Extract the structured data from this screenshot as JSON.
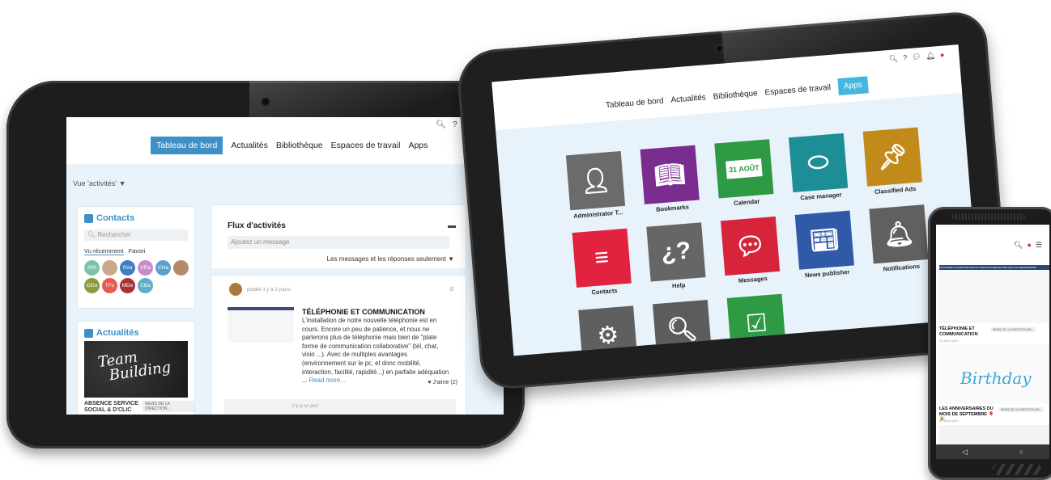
{
  "tablet_left": {
    "nav": {
      "items": [
        "Tableau de bord",
        "Actualités",
        "Bibliothèque",
        "Espaces de travail",
        "Apps"
      ],
      "active_index": 0
    },
    "view_selector": "Vue 'activités' ▼",
    "contacts": {
      "title": "Contacts",
      "search_placeholder": "Rechercher",
      "tabs": [
        "Vu récemment",
        "Favori"
      ],
      "avatars": [
        {
          "initials": "API",
          "color": "#7cc4a8"
        },
        {
          "initials": "",
          "color": "#c9a989"
        },
        {
          "initials": "SVa",
          "color": "#3d7fc4"
        },
        {
          "initials": "VRa",
          "color": "#c98ac9"
        },
        {
          "initials": "CHa",
          "color": "#5aa0d0"
        },
        {
          "initials": "",
          "color": "#b48a6a"
        },
        {
          "initials": "OGo",
          "color": "#8a9a3c"
        },
        {
          "initials": "TFo",
          "color": "#e85a4f"
        },
        {
          "initials": "MDe",
          "color": "#a83232"
        },
        {
          "initials": "CBa",
          "color": "#5bb0c8"
        }
      ]
    },
    "news": {
      "title": "Actualités",
      "image_text": [
        "Team",
        "Building"
      ],
      "item_title": "ABSENCE SERVICE SOCIAL & D'CLIC",
      "item_tag": "NEWS DE LA DIRECTION ..."
    },
    "feed": {
      "title": "Flux d'activités",
      "message_placeholder": "Ajoutez un message",
      "filter": "Les messages et les réponses seulement ▼",
      "post": {
        "meta": "publié il y a 3 jours",
        "title": "TÉLÉPHONIE ET COMMUNICATION",
        "body": "L'installation de notre nouvelle téléphonie est en cours. Encore un peu de patience, et nous ne parlerons plus de téléphonie mais bien de \"plate forme de communication collaborative\" (tél, chat, visio ...). Avec de multiples avantages (environnement sur le pc, et donc mobilité, interaction, facilité, rapidité...) en parfaite adéquation ...",
        "read_more": "Read more...",
        "likes": "♥ J'aime (2)"
      },
      "post2_time": "il y a un jour"
    }
  },
  "tablet_right": {
    "nav": {
      "items": [
        "Tableau de bord",
        "Actualités",
        "Bibliothèque",
        "Espaces de travail",
        "Apps"
      ],
      "active_index": 4
    },
    "apps": [
      {
        "label": "Administrator T...",
        "color": "#6b6b6b",
        "icon": "admin-user-icon"
      },
      {
        "label": "Bookmarks",
        "color": "#7b2d8f",
        "icon": "book-icon"
      },
      {
        "label": "Calendar",
        "color": "#2e9a44",
        "icon": "calendar-icon",
        "tile_text": "31 AOÛT"
      },
      {
        "label": "Case manager",
        "color": "#1e8e96",
        "icon": "case-icon"
      },
      {
        "label": "Classified Ads",
        "color": "#c28a1a",
        "icon": "pin-icon"
      },
      {
        "label": "Contacts",
        "color": "#e2233f",
        "icon": "contact-card-icon"
      },
      {
        "label": "Help",
        "color": "#666666",
        "icon": "help-icon",
        "tile_text": "¿?"
      },
      {
        "label": "Messages",
        "color": "#d8243a",
        "icon": "messages-icon"
      },
      {
        "label": "News publisher",
        "color": "#2f5aa8",
        "icon": "newspaper-icon"
      },
      {
        "label": "Notifications",
        "color": "#606060",
        "icon": "bell-icon"
      },
      {
        "label": "Preferences",
        "color": "#5f5f5f",
        "icon": "gear-icon"
      },
      {
        "label": "Search",
        "color": "#5c5c5c",
        "icon": "search-icon"
      },
      {
        "label": "Todo",
        "color": "#2e9a44",
        "icon": "checkbox-icon"
      }
    ]
  },
  "phone": {
    "banner": "FAVORISER LA PARTICIPATION ET LES ÉCHANGES ENTRE LES COLLABORATEURS",
    "item1": {
      "title": "TÉLÉPHONIE ET COMMUNICATION",
      "tag": "NEWS DE LA DIRECTION GE...",
      "date": "24 Août 2021"
    },
    "item2": {
      "title": "LES ANNIVERSAIRES DU MOIS DE SEPTEMBRE 🎈🎉",
      "tag": "NEWS DE LA DIRECTION GE...",
      "date": "31 Août 2021",
      "image_text": "Birthday"
    }
  }
}
